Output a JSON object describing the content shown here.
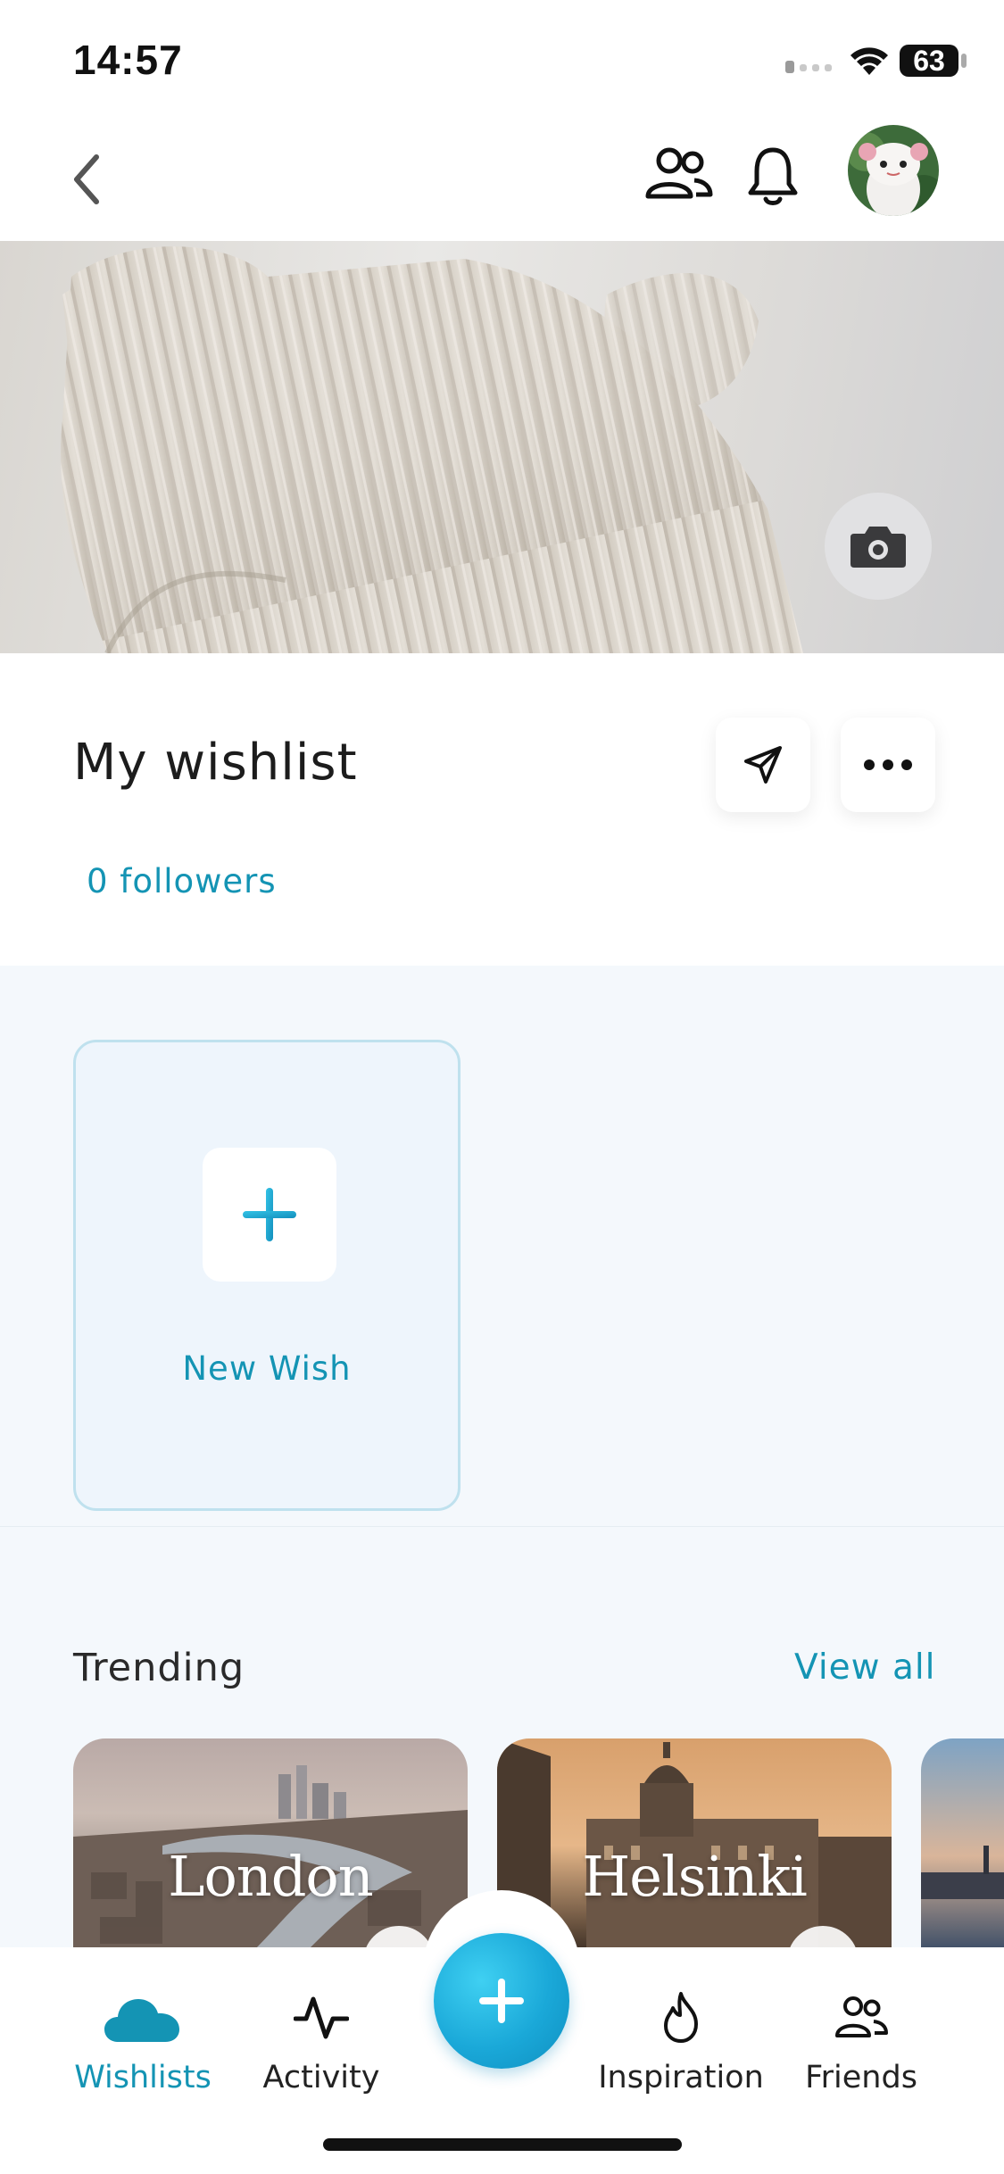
{
  "status_bar": {
    "time": "14:57",
    "battery": "63"
  },
  "header": {
    "back_icon": "chevron-left-icon",
    "friends_icon": "people-icon",
    "notifications_icon": "bell-icon",
    "avatar": "profile-avatar"
  },
  "banner": {
    "camera_icon": "camera-icon"
  },
  "wishlist": {
    "title": "My wishlist",
    "followers": "0 followers",
    "share_icon": "paper-plane-icon",
    "more_icon": "ellipsis-icon"
  },
  "new_wish": {
    "label": "New Wish"
  },
  "trending": {
    "heading": "Trending",
    "view_all": "View all",
    "cards": [
      {
        "label": "London"
      },
      {
        "label": "Helsinki"
      }
    ]
  },
  "tabbar": {
    "items": [
      {
        "label": "Wishlists",
        "icon": "cloud-icon",
        "active": true
      },
      {
        "label": "Activity",
        "icon": "pulse-icon",
        "active": false
      },
      {
        "label": "Inspiration",
        "icon": "flame-icon",
        "active": false
      },
      {
        "label": "Friends",
        "icon": "people-icon",
        "active": false
      }
    ]
  },
  "colors": {
    "accent": "#1494b4",
    "fab": "#1aa8d8",
    "content_bg": "#f4f8fc"
  }
}
